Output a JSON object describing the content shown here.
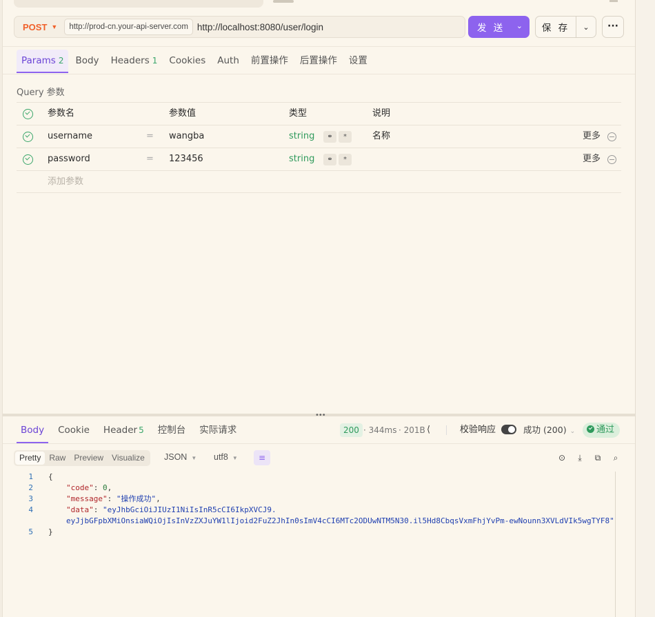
{
  "request": {
    "method": "POST",
    "env_url": "http://prod-cn.your-api-server.com",
    "path": "http://localhost:8080/user/login",
    "send_label": "发 送",
    "save_label": "保 存",
    "more_label": "···"
  },
  "req_tabs": [
    {
      "label": "Params",
      "count": "2"
    },
    {
      "label": "Body",
      "count": ""
    },
    {
      "label": "Headers",
      "count": "1"
    },
    {
      "label": "Cookies",
      "count": ""
    },
    {
      "label": "Auth",
      "count": ""
    },
    {
      "label": "前置操作",
      "count": ""
    },
    {
      "label": "后置操作",
      "count": ""
    },
    {
      "label": "设置",
      "count": ""
    }
  ],
  "query_label": "Query 参数",
  "params_header": {
    "name": "参数名",
    "value": "参数值",
    "type": "类型",
    "desc": "说明"
  },
  "params": [
    {
      "name": "username",
      "eq": "=",
      "value": "wangba",
      "type": "string",
      "desc": "名称",
      "more": "更多"
    },
    {
      "name": "password",
      "eq": "=",
      "value": "123456",
      "type": "string",
      "desc": "",
      "more": "更多"
    }
  ],
  "add_param": "添加参数",
  "response": {
    "tabs": [
      {
        "label": "Body",
        "count": ""
      },
      {
        "label": "Cookie",
        "count": ""
      },
      {
        "label": "Header",
        "count": "5"
      },
      {
        "label": "控制台",
        "count": ""
      },
      {
        "label": "实际请求",
        "count": ""
      }
    ],
    "status_code": "200",
    "time": "· 344ms",
    "size": "· 201B",
    "validate_label": "校验响应",
    "result_select": "成功 (200)",
    "pass_label": "通过",
    "views": [
      "Pretty",
      "Raw",
      "Preview",
      "Visualize"
    ],
    "format": "JSON",
    "encoding": "utf8",
    "body_lines": [
      {
        "n": "1",
        "text": "{"
      },
      {
        "n": "2",
        "key": "\"code\"",
        "sep": ": ",
        "val": "0",
        "vtype": "num",
        "end": ","
      },
      {
        "n": "3",
        "key": "\"message\"",
        "sep": ": ",
        "val": "\"操作成功\"",
        "vtype": "str",
        "end": ","
      },
      {
        "n": "4",
        "key": "\"data\"",
        "sep": ": ",
        "val": "\"eyJhbGciOiJIUzI1NiIsInR5cCI6IkpXVCJ9.",
        "vtype": "str",
        "end": ""
      },
      {
        "n": "",
        "val": "eyJjbGFpbXMiOnsiaWQiOjIsInVzZXJuYW1lIjoid2FuZ2JhIn0sImV4cCI6MTc2ODUwNTM5N30.il5Hd8CbqsVxmFhjYvPm-ewNounn3XVLdVIk5wgTYF8\"",
        "vtype": "str",
        "end": ""
      },
      {
        "n": "5",
        "text": "}"
      }
    ]
  }
}
